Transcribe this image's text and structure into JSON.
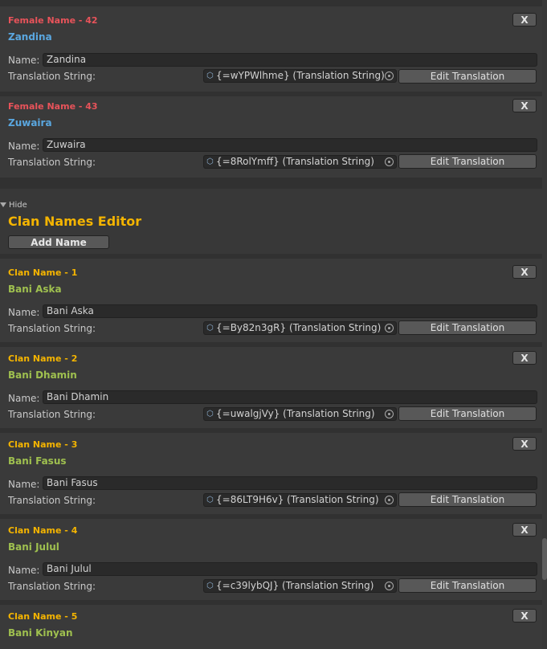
{
  "female_entries": [
    {
      "header": "Female Name - 42",
      "name": "Zandina",
      "name_label": "Name:",
      "name_value": "Zandina",
      "ts_label": "Translation String:",
      "ts_value": "{=wYPWlhme} (Translation String)",
      "edit_label": "Edit Translation",
      "remove_label": "X"
    },
    {
      "header": "Female Name - 43",
      "name": "Zuwaira",
      "name_label": "Name:",
      "name_value": "Zuwaira",
      "ts_label": "Translation String:",
      "ts_value": "{=8RolYmff} (Translation String)",
      "edit_label": "Edit Translation",
      "remove_label": "X"
    }
  ],
  "clan_section": {
    "hide_label": "Hide",
    "title": "Clan Names Editor",
    "add_label": "Add Name"
  },
  "clan_entries": [
    {
      "header": "Clan Name - 1",
      "name": "Bani Aska",
      "name_label": "Name:",
      "name_value": "Bani Aska",
      "ts_label": "Translation String:",
      "ts_value": "{=By82n3gR} (Translation String)",
      "edit_label": "Edit Translation",
      "remove_label": "X"
    },
    {
      "header": "Clan Name - 2",
      "name": "Bani Dhamin",
      "name_label": "Name:",
      "name_value": "Bani Dhamin",
      "ts_label": "Translation String:",
      "ts_value": "{=uwalgjVy} (Translation String)",
      "edit_label": "Edit Translation",
      "remove_label": "X"
    },
    {
      "header": "Clan Name - 3",
      "name": "Bani Fasus",
      "name_label": "Name:",
      "name_value": "Bani Fasus",
      "ts_label": "Translation String:",
      "ts_value": "{=86LT9H6v} (Translation String)",
      "edit_label": "Edit Translation",
      "remove_label": "X"
    },
    {
      "header": "Clan Name - 4",
      "name": "Bani Julul",
      "name_label": "Name:",
      "name_value": "Bani Julul",
      "ts_label": "Translation String:",
      "ts_value": "{=c39lybQJ} (Translation String)",
      "edit_label": "Edit Translation",
      "remove_label": "X"
    },
    {
      "header": "Clan Name - 5",
      "name": "Bani Kinyan",
      "name_label": "Name:",
      "name_value": "",
      "ts_label": "",
      "ts_value": "",
      "edit_label": "",
      "remove_label": "X"
    }
  ],
  "colors": {
    "female_header": "#e8535a",
    "female_name": "#5aa7e0",
    "clan_header": "#f4b400",
    "clan_name": "#9fc04f",
    "background": "#383838"
  }
}
